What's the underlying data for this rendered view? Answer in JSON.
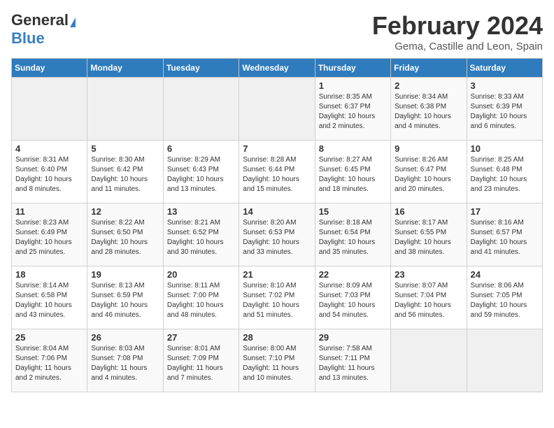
{
  "logo": {
    "general": "General",
    "blue": "Blue"
  },
  "title": "February 2024",
  "location": "Gema, Castille and Leon, Spain",
  "days_of_week": [
    "Sunday",
    "Monday",
    "Tuesday",
    "Wednesday",
    "Thursday",
    "Friday",
    "Saturday"
  ],
  "weeks": [
    [
      {
        "day": "",
        "info": ""
      },
      {
        "day": "",
        "info": ""
      },
      {
        "day": "",
        "info": ""
      },
      {
        "day": "",
        "info": ""
      },
      {
        "day": "1",
        "info": "Sunrise: 8:35 AM\nSunset: 6:37 PM\nDaylight: 10 hours\nand 2 minutes."
      },
      {
        "day": "2",
        "info": "Sunrise: 8:34 AM\nSunset: 6:38 PM\nDaylight: 10 hours\nand 4 minutes."
      },
      {
        "day": "3",
        "info": "Sunrise: 8:33 AM\nSunset: 6:39 PM\nDaylight: 10 hours\nand 6 minutes."
      }
    ],
    [
      {
        "day": "4",
        "info": "Sunrise: 8:31 AM\nSunset: 6:40 PM\nDaylight: 10 hours\nand 8 minutes."
      },
      {
        "day": "5",
        "info": "Sunrise: 8:30 AM\nSunset: 6:42 PM\nDaylight: 10 hours\nand 11 minutes."
      },
      {
        "day": "6",
        "info": "Sunrise: 8:29 AM\nSunset: 6:43 PM\nDaylight: 10 hours\nand 13 minutes."
      },
      {
        "day": "7",
        "info": "Sunrise: 8:28 AM\nSunset: 6:44 PM\nDaylight: 10 hours\nand 15 minutes."
      },
      {
        "day": "8",
        "info": "Sunrise: 8:27 AM\nSunset: 6:45 PM\nDaylight: 10 hours\nand 18 minutes."
      },
      {
        "day": "9",
        "info": "Sunrise: 8:26 AM\nSunset: 6:47 PM\nDaylight: 10 hours\nand 20 minutes."
      },
      {
        "day": "10",
        "info": "Sunrise: 8:25 AM\nSunset: 6:48 PM\nDaylight: 10 hours\nand 23 minutes."
      }
    ],
    [
      {
        "day": "11",
        "info": "Sunrise: 8:23 AM\nSunset: 6:49 PM\nDaylight: 10 hours\nand 25 minutes."
      },
      {
        "day": "12",
        "info": "Sunrise: 8:22 AM\nSunset: 6:50 PM\nDaylight: 10 hours\nand 28 minutes."
      },
      {
        "day": "13",
        "info": "Sunrise: 8:21 AM\nSunset: 6:52 PM\nDaylight: 10 hours\nand 30 minutes."
      },
      {
        "day": "14",
        "info": "Sunrise: 8:20 AM\nSunset: 6:53 PM\nDaylight: 10 hours\nand 33 minutes."
      },
      {
        "day": "15",
        "info": "Sunrise: 8:18 AM\nSunset: 6:54 PM\nDaylight: 10 hours\nand 35 minutes."
      },
      {
        "day": "16",
        "info": "Sunrise: 8:17 AM\nSunset: 6:55 PM\nDaylight: 10 hours\nand 38 minutes."
      },
      {
        "day": "17",
        "info": "Sunrise: 8:16 AM\nSunset: 6:57 PM\nDaylight: 10 hours\nand 41 minutes."
      }
    ],
    [
      {
        "day": "18",
        "info": "Sunrise: 8:14 AM\nSunset: 6:58 PM\nDaylight: 10 hours\nand 43 minutes."
      },
      {
        "day": "19",
        "info": "Sunrise: 8:13 AM\nSunset: 6:59 PM\nDaylight: 10 hours\nand 46 minutes."
      },
      {
        "day": "20",
        "info": "Sunrise: 8:11 AM\nSunset: 7:00 PM\nDaylight: 10 hours\nand 48 minutes."
      },
      {
        "day": "21",
        "info": "Sunrise: 8:10 AM\nSunset: 7:02 PM\nDaylight: 10 hours\nand 51 minutes."
      },
      {
        "day": "22",
        "info": "Sunrise: 8:09 AM\nSunset: 7:03 PM\nDaylight: 10 hours\nand 54 minutes."
      },
      {
        "day": "23",
        "info": "Sunrise: 8:07 AM\nSunset: 7:04 PM\nDaylight: 10 hours\nand 56 minutes."
      },
      {
        "day": "24",
        "info": "Sunrise: 8:06 AM\nSunset: 7:05 PM\nDaylight: 10 hours\nand 59 minutes."
      }
    ],
    [
      {
        "day": "25",
        "info": "Sunrise: 8:04 AM\nSunset: 7:06 PM\nDaylight: 11 hours\nand 2 minutes."
      },
      {
        "day": "26",
        "info": "Sunrise: 8:03 AM\nSunset: 7:08 PM\nDaylight: 11 hours\nand 4 minutes."
      },
      {
        "day": "27",
        "info": "Sunrise: 8:01 AM\nSunset: 7:09 PM\nDaylight: 11 hours\nand 7 minutes."
      },
      {
        "day": "28",
        "info": "Sunrise: 8:00 AM\nSunset: 7:10 PM\nDaylight: 11 hours\nand 10 minutes."
      },
      {
        "day": "29",
        "info": "Sunrise: 7:58 AM\nSunset: 7:11 PM\nDaylight: 11 hours\nand 13 minutes."
      },
      {
        "day": "",
        "info": ""
      },
      {
        "day": "",
        "info": ""
      }
    ]
  ]
}
